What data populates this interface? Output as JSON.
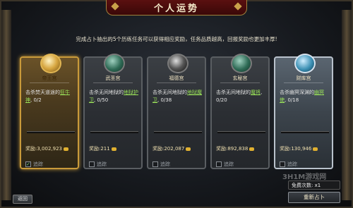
{
  "title": "个人运势",
  "description": "完成占卜抽出的5个历练任务可以获得相应奖励，任务品质越高，回报奖励也更加丰厚!",
  "cards": [
    {
      "name": "帝王宫",
      "task_prefix": "击杀焚天道途的",
      "task_target": "狂牛神",
      "progress": "0/2",
      "reward": "奖励:3,002,923",
      "track_label": "追踪",
      "tracked": true
    },
    {
      "name": "武圣宫",
      "task_prefix": "击杀无间地狱的",
      "task_target": "地狱护卫",
      "progress": "0/50",
      "reward": "奖励:211",
      "track_label": "追踪",
      "tracked": false
    },
    {
      "name": "福德宫",
      "task_prefix": "击杀无间地狱的",
      "task_target": "地狱魔卫",
      "progress": "0/38",
      "reward": "奖励:202,087",
      "track_label": "追踪",
      "tracked": false
    },
    {
      "name": "玄秘宫",
      "task_prefix": "击杀无间地狱的",
      "task_target": "魔将",
      "progress": "0/20",
      "reward": "奖励:892,838",
      "track_label": "追踪",
      "tracked": false
    },
    {
      "name": "财库宫",
      "task_prefix": "击杀幽冥深渊的",
      "task_target": "幽冥使",
      "progress": "0/18",
      "reward": "奖励:130,946",
      "track_label": "追踪",
      "tracked": false
    }
  ],
  "back_label": "返回",
  "free_info": "免费次数: x1",
  "refresh_label": "重新占卜",
  "watermark": "3H1M游戏网"
}
